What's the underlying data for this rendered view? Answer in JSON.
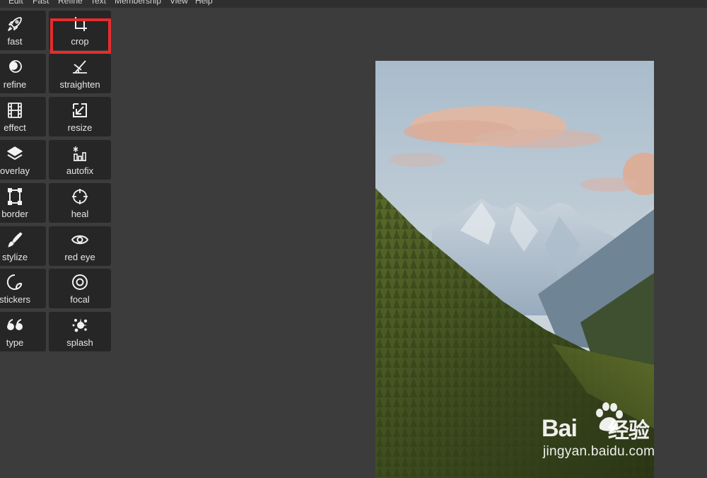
{
  "menubar": {
    "items": [
      "Edit",
      "Fast",
      "Refine",
      "Text",
      "Membership",
      "View",
      "Help"
    ]
  },
  "tools": {
    "left_column": [
      {
        "label": "fast",
        "icon": "rocket-icon"
      },
      {
        "label": "refine",
        "icon": "circles-icon"
      },
      {
        "label": "effect",
        "icon": "film-icon"
      },
      {
        "label": "overlay",
        "icon": "layers-icon"
      },
      {
        "label": "border",
        "icon": "frame-icon"
      },
      {
        "label": "stylize",
        "icon": "brush-icon"
      },
      {
        "label": "stickers",
        "icon": "sticker-icon"
      },
      {
        "label": "type",
        "icon": "quote-icon"
      }
    ],
    "right_column": [
      {
        "label": "crop",
        "icon": "crop-icon"
      },
      {
        "label": "straighten",
        "icon": "straighten-icon"
      },
      {
        "label": "resize",
        "icon": "resize-icon"
      },
      {
        "label": "autofix",
        "icon": "autofix-icon"
      },
      {
        "label": "heal",
        "icon": "crosshair-icon"
      },
      {
        "label": "red eye",
        "icon": "eye-icon"
      },
      {
        "label": "focal",
        "icon": "target-icon"
      },
      {
        "label": "splash",
        "icon": "splash-icon"
      }
    ],
    "selected": "crop",
    "highlight_color": "#e62c2c"
  },
  "watermark": {
    "logo_text_left": "Bai",
    "logo_text_right": "经验",
    "url": "jingyan.baidu.com"
  },
  "colors": {
    "background": "#3c3c3c",
    "menubar": "#2f2f2f",
    "tool_tile": "#262626",
    "tool_text": "#e6e6e6"
  }
}
